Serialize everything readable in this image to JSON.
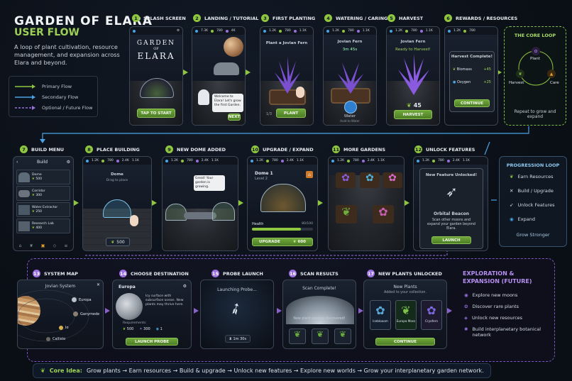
{
  "header": {
    "title": "GARDEN OF ELARA",
    "subtitle": "USER FLOW",
    "description": "A loop of plant cultivation, resource management, and expansion across Elara and beyond."
  },
  "legend": {
    "primary": "Primary Flow",
    "secondary": "Secondary Flow",
    "optional": "Optional / Future Flow"
  },
  "steps": [
    {
      "n": "1",
      "label": "SPLASH SCREEN"
    },
    {
      "n": "2",
      "label": "LANDING / TUTORIAL"
    },
    {
      "n": "3",
      "label": "FIRST PLANTING"
    },
    {
      "n": "4",
      "label": "WATERING / CARING"
    },
    {
      "n": "5",
      "label": "HARVEST"
    },
    {
      "n": "6",
      "label": "REWARDS / RESOURCES"
    },
    {
      "n": "7",
      "label": "BUILD MENU"
    },
    {
      "n": "8",
      "label": "PLACE BUILDING"
    },
    {
      "n": "9",
      "label": "NEW DOME ADDED"
    },
    {
      "n": "10",
      "label": "UPGRADE / EXPAND"
    },
    {
      "n": "11",
      "label": "MORE GARDENS"
    },
    {
      "n": "12",
      "label": "UNLOCK FEATURES"
    },
    {
      "n": "13",
      "label": "SYSTEM MAP"
    },
    {
      "n": "14",
      "label": "CHOOSE DESTINATION"
    },
    {
      "n": "15",
      "label": "PROBE LAUNCH"
    },
    {
      "n": "16",
      "label": "SCAN RESULTS"
    },
    {
      "n": "17",
      "label": "NEW PLANTS UNLOCKED"
    }
  ],
  "hud": {
    "a": "7.3K",
    "b": "780",
    "c": "4K",
    "d": "1.1K",
    "e": "1.2K",
    "f": "2.4K",
    "g": "1.5K",
    "h": "120",
    "i": "2.5K",
    "j": "1.8K",
    "k": "3"
  },
  "s1": {
    "logo_top": "GARDEN",
    "logo_of": "OF",
    "logo_bottom": "ELARA",
    "button": "TAP TO START"
  },
  "s2": {
    "bubble": "Welcome to Elara! Let's grow the first Garden.",
    "button": "NEXT"
  },
  "s3": {
    "title": "Plant a Jovian Fern",
    "button": "PLANT",
    "counter": "1/3"
  },
  "s4": {
    "title": "Jovian Fern",
    "timer": "3m 45s",
    "water": "Water",
    "hint": "Hold to Water"
  },
  "s5": {
    "title": "Jovian Fern",
    "status": "Ready to Harvest!",
    "count": "45",
    "button": "HARVEST"
  },
  "s6": {
    "title": "Harvest Complete!",
    "r1": "Biomass",
    "r1v": "+45",
    "r2": "Oxygen",
    "r2v": "+25",
    "button": "CONTINUE"
  },
  "loop": {
    "title": "THE CORE LOOP",
    "plant": "Plant",
    "care": "Care",
    "harvest": "Harvest",
    "caption": "Repeat to grow and expand"
  },
  "s7": {
    "title": "Build",
    "items": [
      {
        "name": "Dome",
        "cost": "500"
      },
      {
        "name": "Corridor",
        "cost": "300"
      },
      {
        "name": "Water Extractor",
        "cost": "250"
      },
      {
        "name": "Research Lab",
        "cost": "400"
      }
    ]
  },
  "s8": {
    "title": "Dome",
    "hint": "Drag to place",
    "cost": "500"
  },
  "s9": {
    "bubble": "Great! Your garden is growing."
  },
  "s10": {
    "title": "Dome 1",
    "level": "Level 2",
    "health": "Health",
    "health_val": "80/100",
    "health_pct": 0.8,
    "button": "UPGRADE",
    "cost": "600"
  },
  "s12": {
    "title": "New Feature Unlocked!",
    "feature": "Orbital Beacon",
    "desc": "Scan other moons and expand your garden beyond Elara.",
    "button": "LAUNCH"
  },
  "progression": {
    "title": "PROGRESSION LOOP",
    "items": [
      "Earn Resources",
      "Build / Upgrade",
      "Unlock Features",
      "Expand"
    ],
    "footer": "Grow Stronger"
  },
  "s13": {
    "title": "Jovian System",
    "moons": [
      "Europa",
      "Ganymede",
      "Io",
      "Callisto"
    ]
  },
  "s14": {
    "title": "Europa",
    "desc": "Icy surface with subsurface ocean. New plants may thrive here.",
    "req": "Requirements:",
    "c1": "500",
    "c2": "300",
    "c3": "1",
    "button": "LAUNCH PROBE"
  },
  "s15": {
    "title": "Launching Probe...",
    "timer": "1m 30s"
  },
  "s16": {
    "title": "Scan Complete!",
    "desc": "New plant species discovered!"
  },
  "s17": {
    "title": "New Plants",
    "sub": "Added to your collection.",
    "plants": [
      "Iceblooom",
      "Europa Moss",
      "Cryofern"
    ],
    "button": "CONTINUE"
  },
  "exploration": {
    "title": "EXPLORATION & EXPANSION (FUTURE)",
    "items": [
      "Explore new moons",
      "Discover rare plants",
      "Unlock new resources",
      "Build interplanetary botanical network"
    ]
  },
  "core": {
    "label": "Core Idea:",
    "text": "Grow plants → Earn resources → Build & upgrade → Unlock new features → Explore new worlds → Grow your interplanetary garden network."
  },
  "colors": {
    "accent": "#8fc640",
    "purple": "#9a6fe0",
    "blue": "#4aa3e6"
  }
}
